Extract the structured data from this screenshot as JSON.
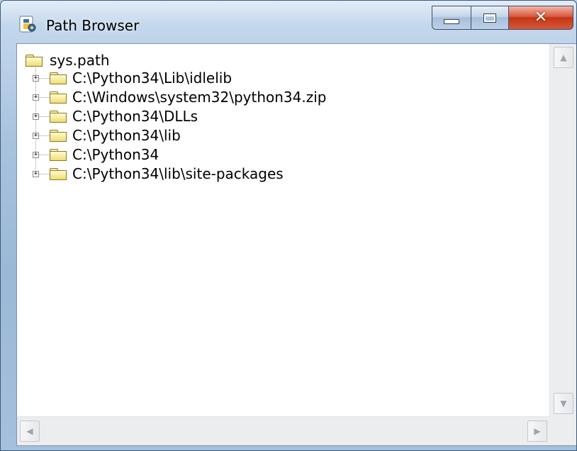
{
  "window": {
    "title": "Path Browser",
    "icon": "python-idle-icon"
  },
  "tree": {
    "root": {
      "label": "sys.path",
      "icon": "folder-icon"
    },
    "items": [
      {
        "label": "C:\\Python34\\Lib\\idlelib",
        "icon": "folder-icon",
        "expander": "+"
      },
      {
        "label": "C:\\Windows\\system32\\python34.zip",
        "icon": "folder-icon",
        "expander": "+"
      },
      {
        "label": "C:\\Python34\\DLLs",
        "icon": "folder-icon",
        "expander": "+"
      },
      {
        "label": "C:\\Python34\\lib",
        "icon": "folder-icon",
        "expander": "+"
      },
      {
        "label": "C:\\Python34",
        "icon": "folder-icon",
        "expander": "+"
      },
      {
        "label": "C:\\Python34\\lib\\site-packages",
        "icon": "folder-icon",
        "expander": "+"
      }
    ]
  },
  "colors": {
    "close_button": "#c23616",
    "folder_fill": "#f1dd72",
    "client_background": "#ffffff"
  }
}
